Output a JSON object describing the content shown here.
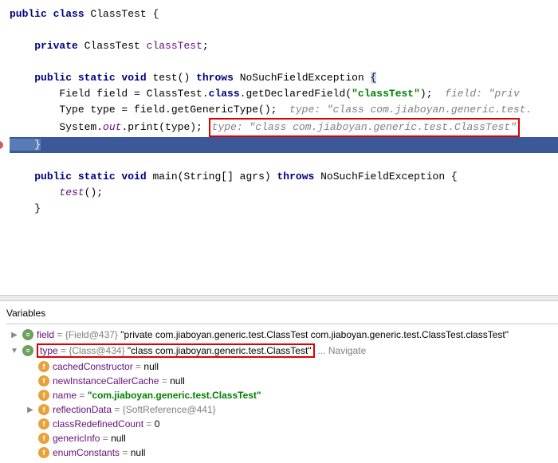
{
  "editor": {
    "l1_kw1": "public class",
    "l1_cls": " ClassTest {",
    "l3_kw": "private",
    "l3_typ": " ClassTest ",
    "l3_fld": "classTest",
    "l3_semi": ";",
    "l5_kw1": "public static void",
    "l5_name": " test() ",
    "l5_kw2": "throws",
    "l5_exc": " NoSuchFieldException ",
    "l5_brace": "{",
    "l6_a": "        Field field = ClassTest.",
    "l6_cls": "class",
    "l6_b": ".getDeclaredField(",
    "l6_str": "\"classTest\"",
    "l6_c": ");  ",
    "l6_cmt": "field: \"priv",
    "l7_a": "        Type type = field.getGenericType();  ",
    "l7_cmt": "type: \"class com.jiaboyan.generic.test.",
    "l8_a": "        System.",
    "l8_out": "out",
    "l8_b": ".print(type); ",
    "l8_cmt": "type: \"class com.jiaboyan.generic.test.ClassTest\"",
    "l9": "    }",
    "l11_kw1": "public static void",
    "l11_name": " main(String[] agrs) ",
    "l11_kw2": "throws",
    "l11_exc": " NoSuchFieldException {",
    "l12_a": "        ",
    "l12_call": "test",
    "l12_b": "();",
    "l13": "    }"
  },
  "vars": {
    "title": "Variables",
    "field": {
      "name": "field",
      "meta": " = {Field@437} ",
      "val": "\"private com.jiaboyan.generic.test.ClassTest com.jiaboyan.generic.test.ClassTest.classTest\""
    },
    "type": {
      "name": "type",
      "meta": " = {Class@434} ",
      "val": "\"class com.jiaboyan.generic.test.ClassTest\"",
      "nav": "... Navigate"
    },
    "children": [
      {
        "name": "cachedConstructor",
        "meta": " = ",
        "val": "null"
      },
      {
        "name": "newInstanceCallerCache",
        "meta": " = ",
        "val": "null"
      },
      {
        "name": "name",
        "meta": " = ",
        "valgreen": "\"com.jiaboyan.generic.test.ClassTest\""
      },
      {
        "name": "reflectionData",
        "meta": " = {SoftReference@441}",
        "val": ""
      },
      {
        "name": "classRedefinedCount",
        "meta": " = ",
        "val": "0"
      },
      {
        "name": "genericInfo",
        "meta": " = ",
        "val": "null"
      },
      {
        "name": "enumConstants",
        "meta": " = ",
        "val": "null"
      }
    ]
  }
}
